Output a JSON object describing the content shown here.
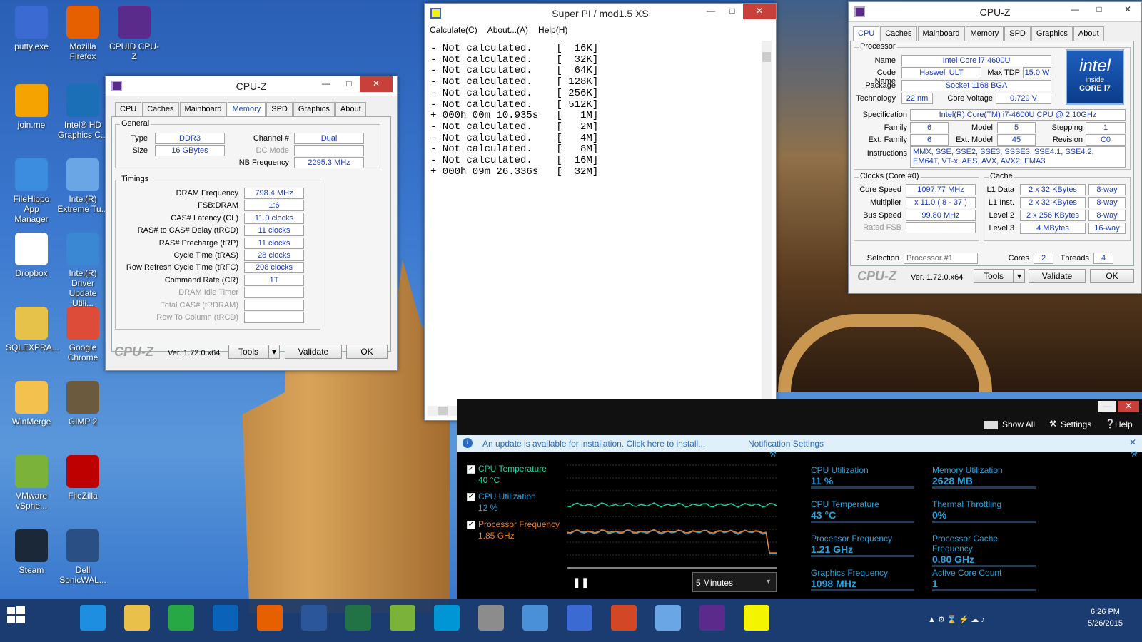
{
  "desktop_icons": [
    {
      "label": "putty.exe",
      "color": "#3b6bd2"
    },
    {
      "label": "Mozilla Firefox",
      "color": "#e66000"
    },
    {
      "label": "CPUID CPU-Z",
      "color": "#5b2b8c"
    },
    {
      "label": "join.me",
      "color": "#f4a300"
    },
    {
      "label": "Intel® HD Graphics C...",
      "color": "#1a6fb5"
    },
    {
      "label": "FileHippo App Manager",
      "color": "#3c8de0"
    },
    {
      "label": "Intel(R) Extreme Tu...",
      "color": "#6aa5e5"
    },
    {
      "label": "Dropbox",
      "color": "#ffffff"
    },
    {
      "label": "Intel(R) Driver Update Utili...",
      "color": "#3a88d3"
    },
    {
      "label": "SQLEXPRA...",
      "color": "#e7c24a"
    },
    {
      "label": "Google Chrome",
      "color": "#dd4b39"
    },
    {
      "label": "WinMerge",
      "color": "#f2c14e"
    },
    {
      "label": "GIMP 2",
      "color": "#6b5a3e"
    },
    {
      "label": "VMware vSphe...",
      "color": "#7bb33a"
    },
    {
      "label": "FileZilla",
      "color": "#bf0000"
    },
    {
      "label": "Steam",
      "color": "#1b2838"
    },
    {
      "label": "Dell SonicWAL...",
      "color": "#2a4f85"
    }
  ],
  "cpuz_mem": {
    "title": "CPU-Z",
    "tabs": [
      "CPU",
      "Caches",
      "Mainboard",
      "Memory",
      "SPD",
      "Graphics",
      "About"
    ],
    "active_tab": "Memory",
    "general_label": "General",
    "type_label": "Type",
    "type_value": "DDR3",
    "size_label": "Size",
    "size_value": "16 GBytes",
    "channel_label": "Channel #",
    "channel_value": "Dual",
    "dcmode_label": "DC Mode",
    "dcmode_value": "",
    "nbfreq_label": "NB Frequency",
    "nbfreq_value": "2295.3 MHz",
    "timings_label": "Timings",
    "timings": [
      {
        "label": "DRAM Frequency",
        "value": "798.4 MHz",
        "dim": false
      },
      {
        "label": "FSB:DRAM",
        "value": "1:6",
        "dim": false
      },
      {
        "label": "CAS# Latency (CL)",
        "value": "11.0 clocks",
        "dim": false
      },
      {
        "label": "RAS# to CAS# Delay (tRCD)",
        "value": "11 clocks",
        "dim": false
      },
      {
        "label": "RAS# Precharge (tRP)",
        "value": "11 clocks",
        "dim": false
      },
      {
        "label": "Cycle Time (tRAS)",
        "value": "28 clocks",
        "dim": false
      },
      {
        "label": "Row Refresh Cycle Time (tRFC)",
        "value": "208 clocks",
        "dim": false
      },
      {
        "label": "Command Rate (CR)",
        "value": "1T",
        "dim": false
      },
      {
        "label": "DRAM Idle Timer",
        "value": "",
        "dim": true
      },
      {
        "label": "Total CAS# (tRDRAM)",
        "value": "",
        "dim": true
      },
      {
        "label": "Row To Column (tRCD)",
        "value": "",
        "dim": true
      }
    ],
    "brand": "CPU-Z",
    "version": "Ver. 1.72.0.x64",
    "tools": "Tools",
    "validate": "Validate",
    "ok": "OK"
  },
  "superpi": {
    "title": "Super PI / mod1.5 XS",
    "menu": [
      "Calculate(C)",
      "About...(A)",
      "Help(H)"
    ],
    "lines": [
      "- Not calculated.    [  16K]",
      "- Not calculated.    [  32K]",
      "- Not calculated.    [  64K]",
      "- Not calculated.    [ 128K]",
      "- Not calculated.    [ 256K]",
      "- Not calculated.    [ 512K]",
      "+ 000h 00m 10.935s   [   1M]",
      "- Not calculated.    [   2M]",
      "- Not calculated.    [   4M]",
      "- Not calculated.    [   8M]",
      "- Not calculated.    [  16M]",
      "+ 000h 09m 26.336s   [  32M]"
    ]
  },
  "cpuz_cpu": {
    "title": "CPU-Z",
    "tabs": [
      "CPU",
      "Caches",
      "Mainboard",
      "Memory",
      "SPD",
      "Graphics",
      "About"
    ],
    "active_tab": "CPU",
    "processor_label": "Processor",
    "name_label": "Name",
    "name": "Intel Core i7 4600U",
    "codename_label": "Code Name",
    "codename": "Haswell ULT",
    "maxtdp_label": "Max TDP",
    "maxtdp": "15.0 W",
    "package_label": "Package",
    "package": "Socket 1168 BGA",
    "tech_label": "Technology",
    "tech": "22 nm",
    "voltage_label": "Core Voltage",
    "voltage": "0.729 V",
    "spec_label": "Specification",
    "spec": "Intel(R) Core(TM) i7-4600U CPU @ 2.10GHz",
    "family_label": "Family",
    "family": "6",
    "model_label": "Model",
    "model": "5",
    "stepping_label": "Stepping",
    "stepping": "1",
    "extfamily_label": "Ext. Family",
    "extfamily": "6",
    "extmodel_label": "Ext. Model",
    "extmodel": "45",
    "revision_label": "Revision",
    "revision": "C0",
    "instr_label": "Instructions",
    "instructions": "MMX, SSE, SSE2, SSE3, SSSE3, SSE4.1, SSE4.2, EM64T, VT-x, AES, AVX, AVX2, FMA3",
    "clocks_label": "Clocks (Core #0)",
    "corespeed_label": "Core Speed",
    "corespeed": "1097.77 MHz",
    "multiplier_label": "Multiplier",
    "multiplier": "x 11.0 ( 8 - 37 )",
    "busspeed_label": "Bus Speed",
    "busspeed": "99.80 MHz",
    "ratedfsb_label": "Rated FSB",
    "ratedfsb": "",
    "cache_label": "Cache",
    "cache": [
      {
        "label": "L1 Data",
        "size": "2 x 32 KBytes",
        "way": "8-way"
      },
      {
        "label": "L1 Inst.",
        "size": "2 x 32 KBytes",
        "way": "8-way"
      },
      {
        "label": "Level 2",
        "size": "2 x 256 KBytes",
        "way": "8-way"
      },
      {
        "label": "Level 3",
        "size": "4 MBytes",
        "way": "16-way"
      }
    ],
    "selection_label": "Selection",
    "selection": "Processor #1",
    "cores_label": "Cores",
    "cores": "2",
    "threads_label": "Threads",
    "threads": "4",
    "intel_logo": "intel",
    "intel_inside": "inside",
    "intel_core": "CORE i7",
    "brand": "CPU-Z",
    "version": "Ver. 1.72.0.x64",
    "tools": "Tools",
    "validate": "Validate",
    "ok": "OK"
  },
  "xtu": {
    "showall": "Show All",
    "settings": "Settings",
    "help": "Help",
    "notice": "An update is available for installation. Click here to install...",
    "notif_settings": "Notification Settings",
    "legend": [
      {
        "name": "CPU Temperature",
        "value": "40 °C",
        "color": "#19d2a6"
      },
      {
        "name": "CPU Utilization",
        "value": "12 %",
        "color": "#27a3e2"
      },
      {
        "name": "Processor Frequency",
        "value": "1.85 GHz",
        "color": "#f07a22"
      }
    ],
    "time_range": "5 Minutes",
    "stats": [
      {
        "name": "CPU Utilization",
        "value": "11 %"
      },
      {
        "name": "Memory Utilization",
        "value": "2628  MB"
      },
      {
        "name": "CPU Temperature",
        "value": "43 °C"
      },
      {
        "name": "Thermal Throttling",
        "value": "0%"
      },
      {
        "name": "Processor Frequency",
        "value": "1.21 GHz"
      },
      {
        "name": "Processor Cache Frequency",
        "value": "0.80 GHz"
      },
      {
        "name": "Graphics Frequency",
        "value": "1098 MHz"
      },
      {
        "name": "Active Core Count",
        "value": "1"
      }
    ]
  },
  "taskbar": {
    "time": "6:26 PM",
    "date": "5/26/2015",
    "apps": [
      {
        "name": "start",
        "color": "#ffffff"
      },
      {
        "name": "internet-explorer",
        "color": "#1e8fe0"
      },
      {
        "name": "file-explorer",
        "color": "#e8c04a"
      },
      {
        "name": "store",
        "color": "#27a844"
      },
      {
        "name": "outlook",
        "color": "#0a63b8"
      },
      {
        "name": "firefox",
        "color": "#e66000"
      },
      {
        "name": "word",
        "color": "#2b579a"
      },
      {
        "name": "excel",
        "color": "#217346"
      },
      {
        "name": "vmware",
        "color": "#7bb33a"
      },
      {
        "name": "hp",
        "color": "#0096d6"
      },
      {
        "name": "calculator",
        "color": "#8c8c8c"
      },
      {
        "name": "remote-desktop",
        "color": "#4a90d9"
      },
      {
        "name": "putty",
        "color": "#3b6bd2"
      },
      {
        "name": "powerpoint",
        "color": "#d24726"
      },
      {
        "name": "intel-xtu",
        "color": "#6aa5e5"
      },
      {
        "name": "cpuz",
        "color": "#5b2b8c"
      },
      {
        "name": "superpi",
        "color": "#f4f400"
      }
    ]
  }
}
